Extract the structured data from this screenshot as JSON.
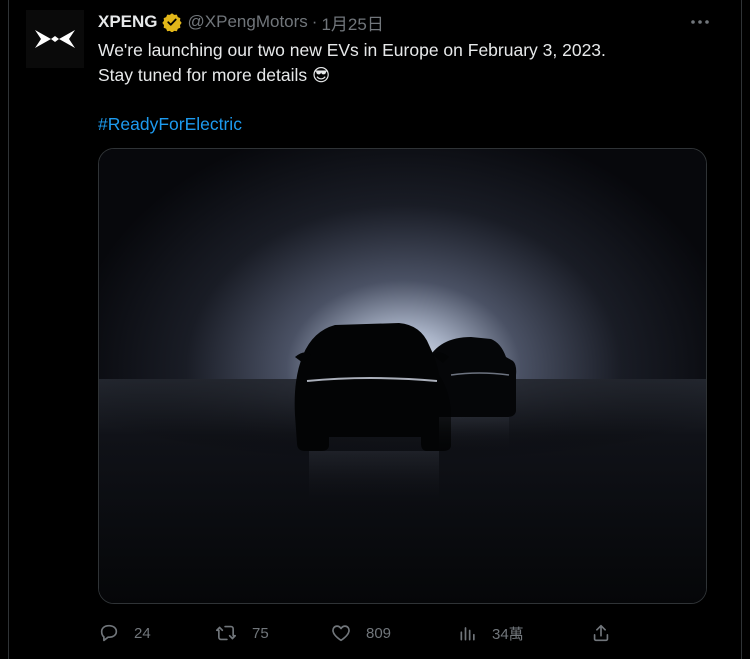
{
  "tweet": {
    "author_name": "XPENG",
    "handle": "@XPengMotors",
    "separator": "·",
    "date": "1月25日",
    "line1": "We're launching our two new EVs in Europe on February 3, 2023.",
    "line2": "Stay tuned for more details 😎",
    "hashtag": "#ReadyForElectric"
  },
  "actions": {
    "replies": "24",
    "retweets": "75",
    "likes": "809",
    "views": "34萬"
  },
  "colors": {
    "background": "#000000",
    "text": "#e7e9ea",
    "muted": "#71767b",
    "link": "#1d9bf0",
    "verified": "#e2b719"
  },
  "icons": [
    "x-logo-icon",
    "verified-badge-icon",
    "more-icon",
    "reply-icon",
    "retweet-icon",
    "like-icon",
    "views-icon",
    "share-icon"
  ]
}
